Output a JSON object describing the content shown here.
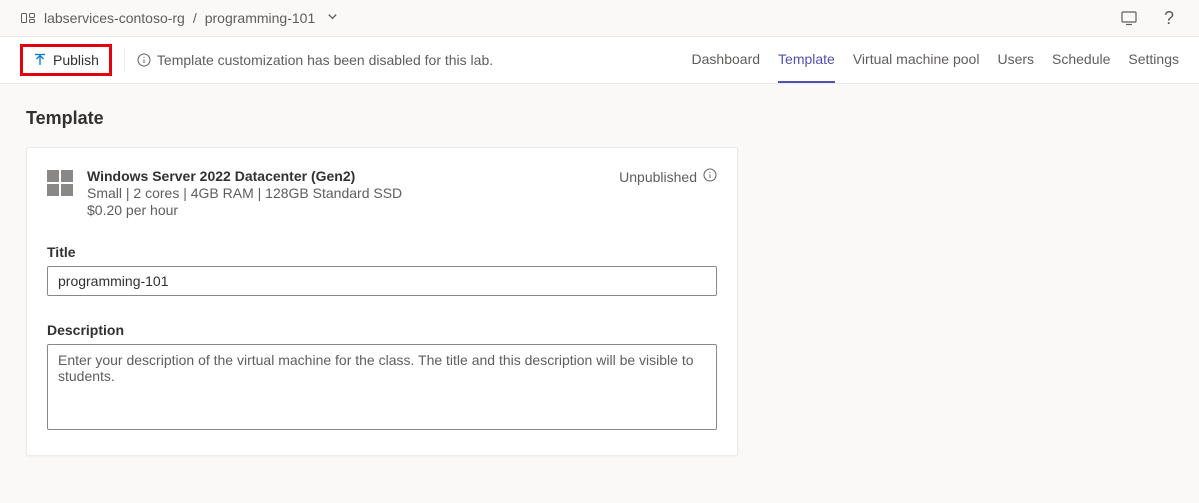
{
  "breadcrumb": {
    "root": "labservices-contoso-rg",
    "current": "programming-101"
  },
  "toolbar": {
    "publish_label": "Publish",
    "info_message": "Template customization has been disabled for this lab."
  },
  "tabs": {
    "dashboard": "Dashboard",
    "template": "Template",
    "vm_pool": "Virtual machine pool",
    "users": "Users",
    "schedule": "Schedule",
    "settings": "Settings"
  },
  "page": {
    "title": "Template"
  },
  "vm": {
    "name": "Windows Server 2022 Datacenter (Gen2)",
    "specs": "Small | 2 cores | 4GB RAM | 128GB Standard SSD",
    "price": "$0.20 per hour",
    "status": "Unpublished"
  },
  "form": {
    "title_label": "Title",
    "title_value": "programming-101",
    "description_label": "Description",
    "description_placeholder": "Enter your description of the virtual machine for the class. The title and this description will be visible to students."
  }
}
